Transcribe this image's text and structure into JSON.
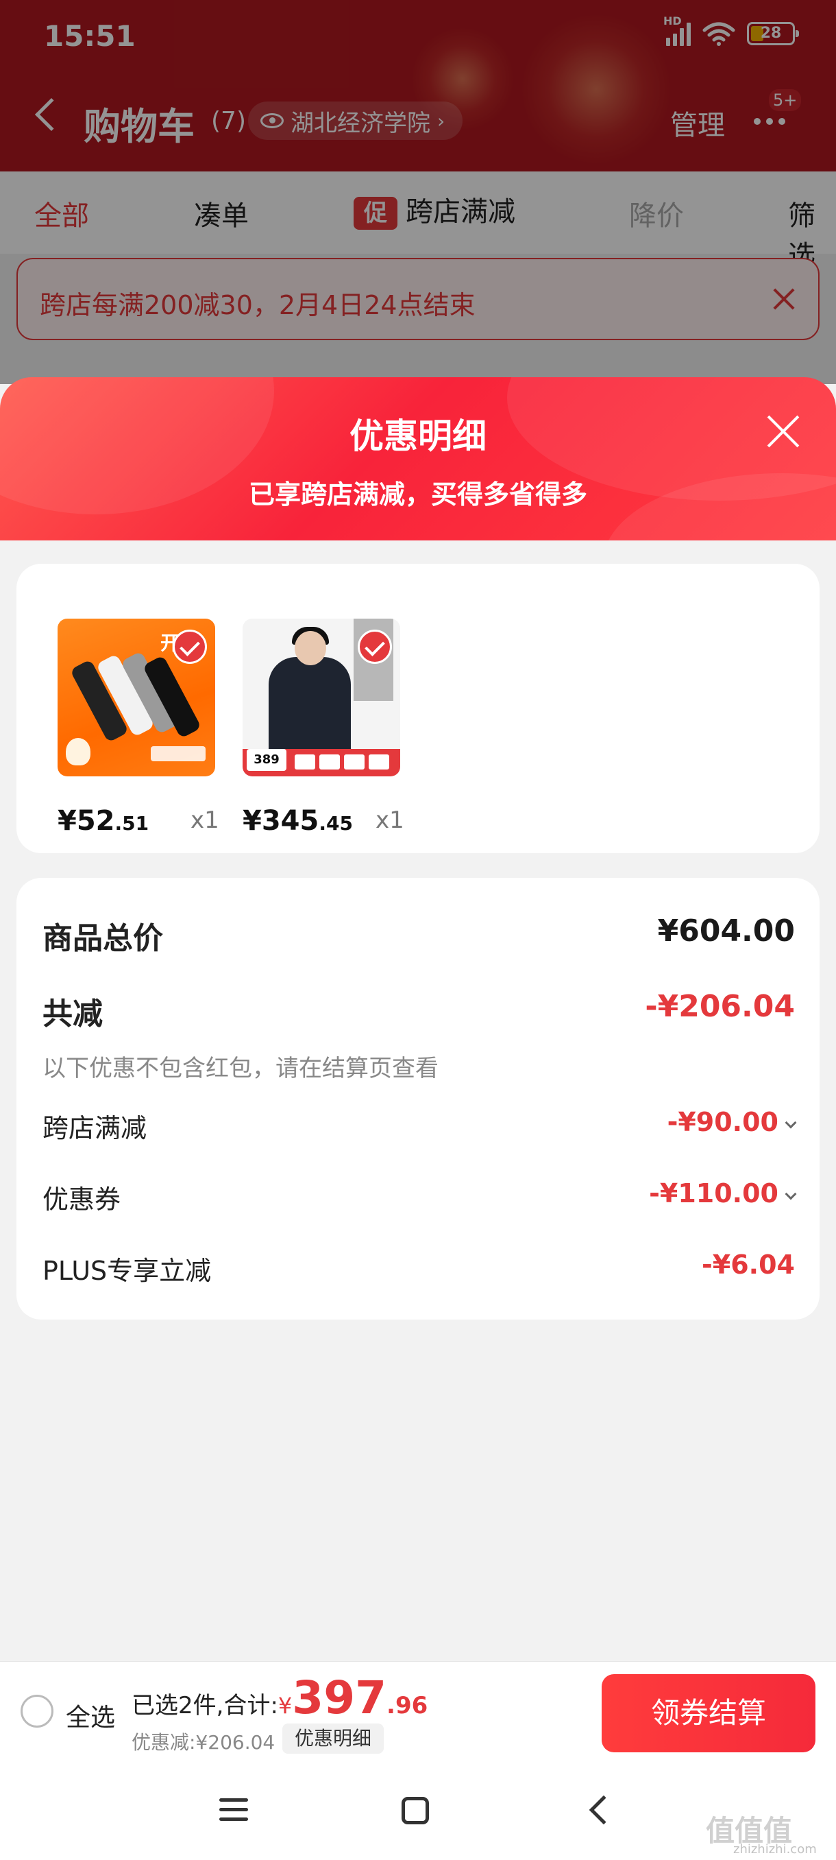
{
  "status_bar": {
    "time": "15:51",
    "network_label": "HD",
    "battery": "28"
  },
  "header": {
    "title": "购物车",
    "count": "(7)",
    "location": "湖北经济学院",
    "manage": "管理",
    "msg_badge": "5+"
  },
  "tabs": [
    {
      "label": "全部",
      "state": "active"
    },
    {
      "label": "凑单",
      "state": "normal"
    },
    {
      "label": "跨店满减",
      "state": "promo",
      "badge": "促"
    },
    {
      "label": "降价",
      "state": "dim"
    },
    {
      "label": "筛选",
      "state": "normal"
    }
  ],
  "notice": {
    "text": "跨店每满200减30，2月4日24点结束"
  },
  "sheet": {
    "title": "优惠明细",
    "subtitle": "已享跨店满减，买得多省得多"
  },
  "products": [
    {
      "price_int": "¥52",
      "price_dec": ".51",
      "qty": "x1",
      "image": "orange-socks-product",
      "selected": true,
      "badge_text": "开"
    },
    {
      "price_int": "¥345",
      "price_dec": ".45",
      "qty": "x1",
      "image": "black-down-jacket-product",
      "selected": true,
      "badge_text": "389"
    }
  ],
  "summary": {
    "total_label": "商品总价",
    "total_value": "¥604.00",
    "reduce_label": "共减",
    "reduce_value": "-¥206.04",
    "note": "以下优惠不包含红包，请在结算页查看",
    "items": [
      {
        "label": "跨店满减",
        "value": "-¥90.00",
        "expandable": true
      },
      {
        "label": "优惠券",
        "value": "-¥110.00",
        "expandable": true
      },
      {
        "label": "PLUS专享立减",
        "value": "-¥6.04",
        "expandable": false
      }
    ]
  },
  "checkout": {
    "select_all": "全选",
    "selected_text": "已选2件,合计:",
    "currency": "¥",
    "total_int": "397",
    "total_dec": ".96",
    "discount_text": "优惠减:¥206.04",
    "detail_button": "优惠明细",
    "checkout_button": "领券结算"
  },
  "watermark": {
    "main": "值值值",
    "sub": "zhizhizhi.com"
  },
  "colors": {
    "accent": "#e4393c",
    "header_bg": "#b0181f",
    "sheet_gradient_start": "#ff5a4f"
  }
}
